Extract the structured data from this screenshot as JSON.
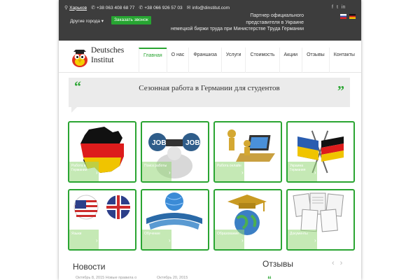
{
  "topbar": {
    "city": "Харьков",
    "phone1": "+38 063 408 68 77",
    "phone2": "+38 066 926 57 03",
    "email": "info@dinstitut.com",
    "other_cities": "Другие города ▾",
    "call_button": "Заказать звонок",
    "partner_line1": "Партнер официального",
    "partner_line2": "представителя в Украине",
    "partner_line3": "немецкой биржи труда при Министерстве Труда Германии",
    "socials": [
      "f",
      "t",
      "in"
    ]
  },
  "logo": {
    "line1": "Deutsches",
    "line2": "Institut"
  },
  "menu": {
    "items": [
      "Главная",
      "О нас",
      "Франшиза",
      "Услуги",
      "Стоимость",
      "Акции",
      "Отзывы",
      "Контакты"
    ],
    "active_index": 0
  },
  "banner": {
    "text": "Сезонная работа в Германии для студентов",
    "quote_open": "“",
    "quote_close": "”"
  },
  "tiles": [
    {
      "icon": "germany-map-icon",
      "label": "Работа в Германии"
    },
    {
      "icon": "job-binoculars-icon",
      "label": "Поиск работы"
    },
    {
      "icon": "laptop-figures-icon",
      "label": "Работа онлайн"
    },
    {
      "icon": "ukraine-germany-flags-icon",
      "label": "Украина Германия"
    },
    {
      "icon": "us-uk-flags-icon",
      "label": "Языки"
    },
    {
      "icon": "globe-books-icon",
      "label": "Обучение"
    },
    {
      "icon": "graduation-globe-icon",
      "label": "Образование"
    },
    {
      "icon": "documents-icon",
      "label": "Документы"
    }
  ],
  "news": {
    "title": "Новости",
    "meta1": "Октябрь 8, 2015 Новые правила о",
    "meta2": "Октябрь 20, 2015"
  },
  "reviews": {
    "title": "Отзывы",
    "prev": "‹",
    "next": "›"
  },
  "colors": {
    "accent": "#2aa532",
    "topbar": "#3d3d3d"
  }
}
